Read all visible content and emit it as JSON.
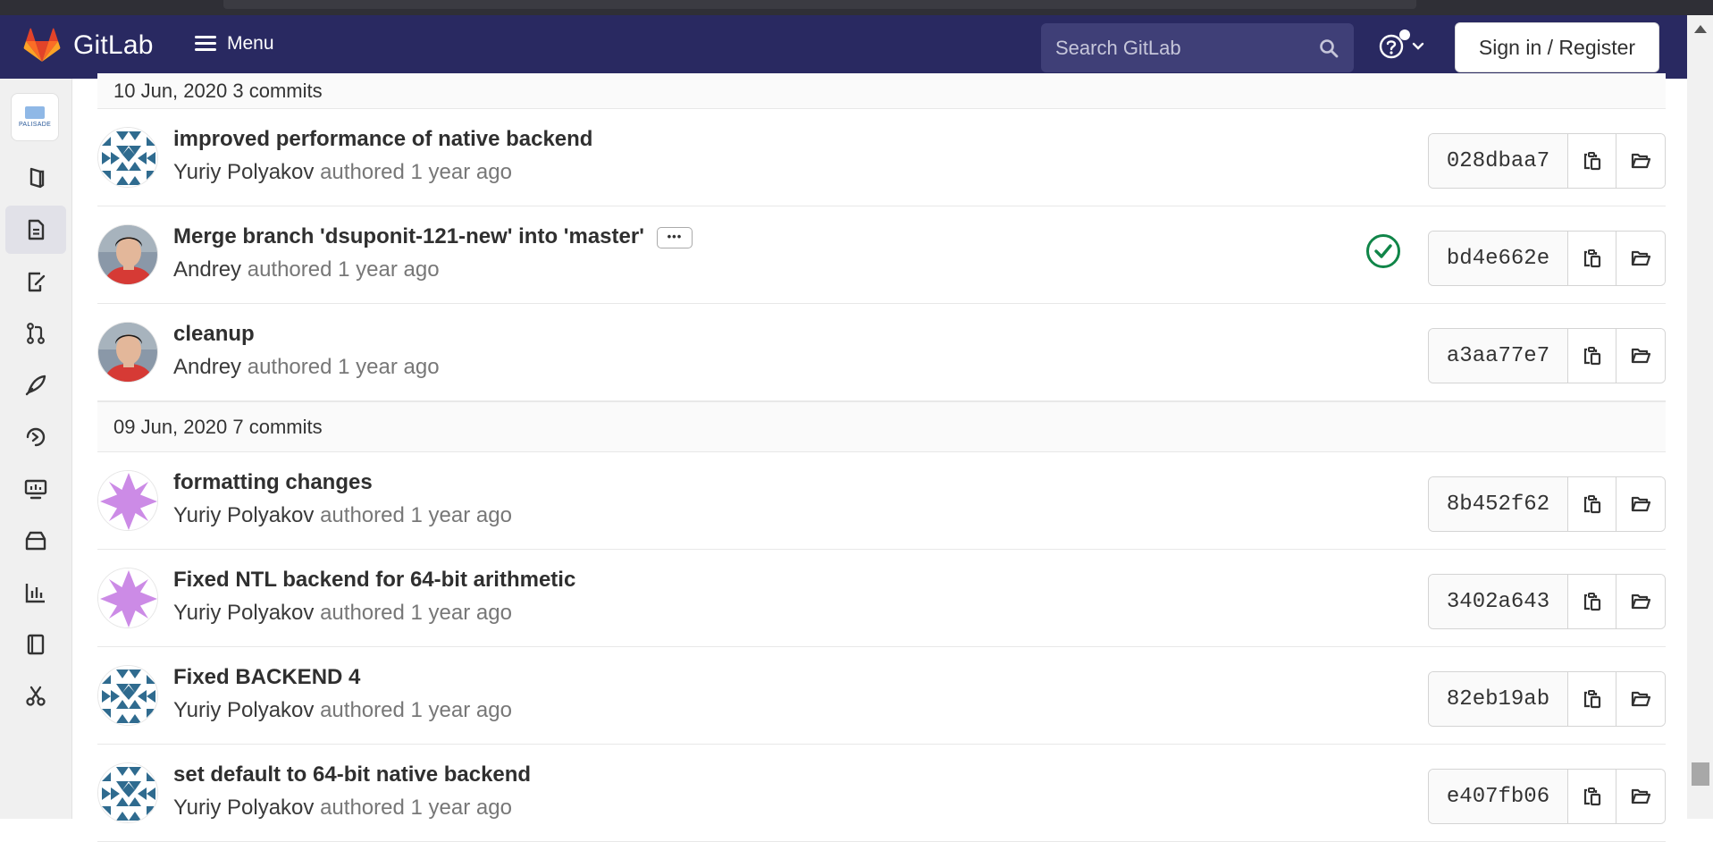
{
  "navbar": {
    "brand": "GitLab",
    "menu_label": "Menu",
    "search_placeholder": "Search GitLab",
    "sign_in_label": "Sign in / Register"
  },
  "project": {
    "avatar_text": "PALISADE"
  },
  "sidebar": {
    "items": [
      {
        "name": "project-overview-icon"
      },
      {
        "name": "repository-icon",
        "active": true
      },
      {
        "name": "issues-icon"
      },
      {
        "name": "merge-requests-icon"
      },
      {
        "name": "ci-cd-icon"
      },
      {
        "name": "deployments-icon"
      },
      {
        "name": "monitor-icon"
      },
      {
        "name": "packages-icon"
      },
      {
        "name": "analytics-icon"
      },
      {
        "name": "wiki-icon"
      },
      {
        "name": "snippets-icon"
      }
    ]
  },
  "commit_groups": [
    {
      "date": "10 Jun, 2020",
      "count": "3 commits",
      "commits": [
        {
          "title": "improved performance of native backend",
          "author": "Yuriy Polyakov",
          "authored": "authored",
          "time": "1 year ago",
          "sha": "028dbaa7",
          "avatar": "geometric-blue",
          "pipeline": false,
          "has_more": false
        },
        {
          "title": "Merge branch 'dsuponit-121-new' into 'master'",
          "author": "Andrey",
          "authored": "authored",
          "time": "1 year ago",
          "sha": "bd4e662e",
          "avatar": "photo",
          "pipeline": true,
          "has_more": true,
          "more_label": "•••"
        },
        {
          "title": "cleanup",
          "author": "Andrey",
          "authored": "authored",
          "time": "1 year ago",
          "sha": "a3aa77e7",
          "avatar": "photo",
          "pipeline": false,
          "has_more": false
        }
      ]
    },
    {
      "date": "09 Jun, 2020",
      "count": "7 commits",
      "commits": [
        {
          "title": "formatting changes",
          "author": "Yuriy Polyakov",
          "authored": "authored",
          "time": "1 year ago",
          "sha": "8b452f62",
          "avatar": "geometric-purple",
          "pipeline": false,
          "has_more": false
        },
        {
          "title": "Fixed NTL backend for 64-bit arithmetic",
          "author": "Yuriy Polyakov",
          "authored": "authored",
          "time": "1 year ago",
          "sha": "3402a643",
          "avatar": "geometric-purple",
          "pipeline": false,
          "has_more": false
        },
        {
          "title": "Fixed BACKEND 4",
          "author": "Yuriy Polyakov",
          "authored": "authored",
          "time": "1 year ago",
          "sha": "82eb19ab",
          "avatar": "geometric-blue",
          "pipeline": false,
          "has_more": false
        },
        {
          "title": "set default to 64-bit native backend",
          "author": "Yuriy Polyakov",
          "authored": "authored",
          "time": "1 year ago",
          "sha": "e407fb06",
          "avatar": "geometric-blue",
          "pipeline": false,
          "has_more": false
        }
      ]
    }
  ],
  "colors": {
    "navbar_bg": "#292961",
    "search_bg": "#3f3f77",
    "pipeline_success": "#108548",
    "avatar_blue": "#2f6b8f",
    "avatar_purple": "#cc8be6"
  }
}
